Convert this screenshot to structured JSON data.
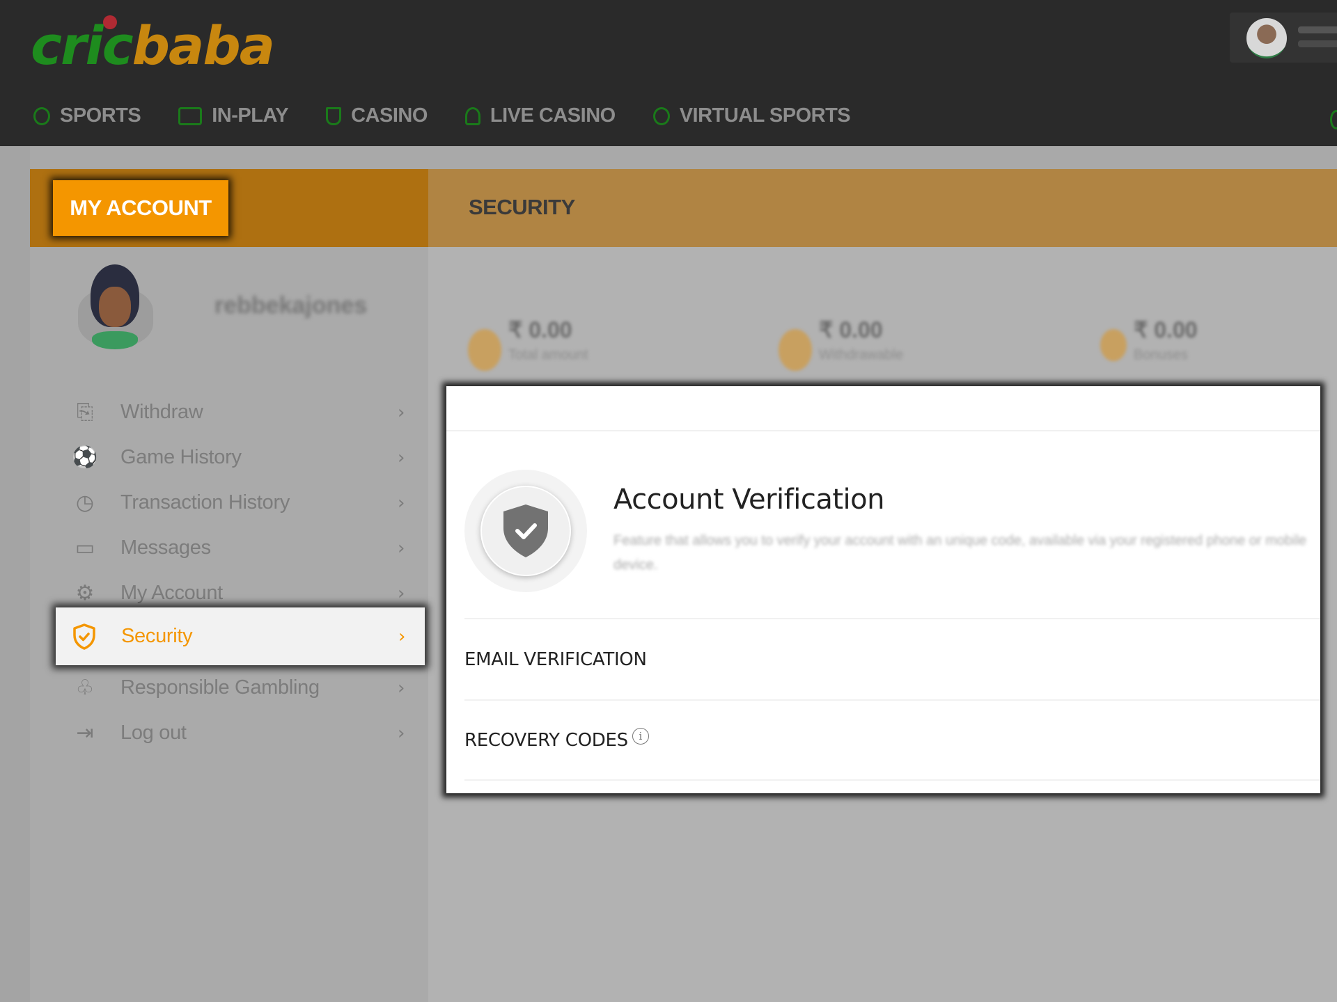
{
  "header": {
    "logo_part1": "cric",
    "logo_part2": "baba",
    "nav": [
      {
        "label": "SPORTS",
        "icon": "sports-icon"
      },
      {
        "label": "IN-PLAY",
        "icon": "play-icon"
      },
      {
        "label": "CASINO",
        "icon": "casino-icon"
      },
      {
        "label": "LIVE CASINO",
        "icon": "spade-icon"
      },
      {
        "label": "VIRTUAL SPORTS",
        "icon": "virtual-sports-icon"
      }
    ]
  },
  "account": {
    "button_label": "MY ACCOUNT",
    "section_title": "SECURITY",
    "username": "rebbekajones"
  },
  "balances": [
    {
      "amount": "₹ 0.00",
      "label": "Total amount"
    },
    {
      "amount": "₹ 0.00",
      "label": "Withdrawable"
    },
    {
      "amount": "₹ 0.00",
      "label": "Bonuses"
    }
  ],
  "menu": {
    "items": [
      {
        "label": "Withdraw",
        "icon": "withdraw-icon",
        "glyph": "⎘"
      },
      {
        "label": "Game History",
        "icon": "game-history-icon",
        "glyph": "⚽"
      },
      {
        "label": "Transaction History",
        "icon": "transaction-history-icon",
        "glyph": "◷"
      },
      {
        "label": "Messages",
        "icon": "messages-icon",
        "glyph": "▭"
      },
      {
        "label": "My Account",
        "icon": "gear-icon",
        "glyph": "⚙"
      }
    ],
    "active": {
      "label": "Security",
      "icon": "shield-check-icon"
    },
    "items_after": [
      {
        "label": "Responsible Gambling",
        "icon": "responsible-gambling-icon",
        "glyph": "♧"
      },
      {
        "label": "Log out",
        "icon": "logout-icon",
        "glyph": "⇥"
      }
    ],
    "chevron": "›"
  },
  "panel": {
    "title": "Account Verification",
    "description": "Feature that allows you to verify your account with an unique code, available via your registered phone or mobile device.",
    "rows": [
      {
        "label": "EMAIL VERIFICATION"
      },
      {
        "label": "RECOVERY CODES",
        "info_icon": "ⓘ"
      }
    ]
  },
  "colors": {
    "accent": "#f49600",
    "brand_green": "#1e8c1e",
    "brand_orange": "#c8870f",
    "header_bg": "#2a2a2a"
  }
}
